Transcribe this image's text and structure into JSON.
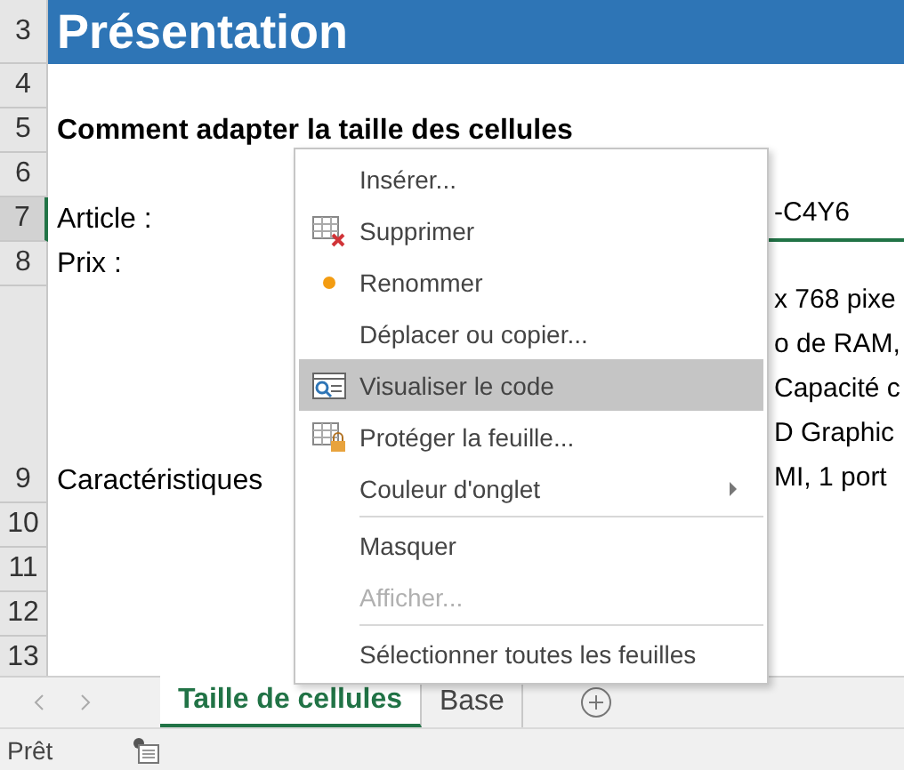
{
  "rows": [
    {
      "number": "3",
      "kind": "title",
      "selected": false,
      "label": "Présentation"
    },
    {
      "number": "4",
      "kind": "normal",
      "selected": false
    },
    {
      "number": "5",
      "kind": "heading",
      "selected": false,
      "label": "Comment adapter la taille des cellules"
    },
    {
      "number": "6",
      "kind": "normal",
      "selected": false
    },
    {
      "number": "7",
      "kind": "normal",
      "selected": true,
      "label": "Article :",
      "right_lines": [
        "-C4Y6"
      ]
    },
    {
      "number": "8",
      "kind": "normal",
      "selected": false,
      "label": "Prix :"
    },
    {
      "number": "9",
      "kind": "tall",
      "selected": false,
      "label": "Caractéristiques",
      "right_lines": [
        "x 768 pixe",
        "o de RAM,",
        "Capacité c",
        "D Graphic",
        "MI, 1 port"
      ]
    },
    {
      "number": "10",
      "kind": "normal",
      "selected": false
    },
    {
      "number": "11",
      "kind": "normal",
      "selected": false
    },
    {
      "number": "12",
      "kind": "normal",
      "selected": false
    },
    {
      "number": "13",
      "kind": "normal",
      "selected": false
    }
  ],
  "context_menu": [
    {
      "label": "Insérer...",
      "kind": "plain",
      "disabled": false,
      "selected": false,
      "submenu": false,
      "separator_before": false
    },
    {
      "label": "Supprimer",
      "kind": "delete",
      "disabled": false,
      "selected": false,
      "submenu": false,
      "separator_before": false
    },
    {
      "label": "Renommer",
      "kind": "dot",
      "disabled": false,
      "selected": false,
      "submenu": false,
      "separator_before": false
    },
    {
      "label": "Déplacer ou copier...",
      "kind": "plain",
      "disabled": false,
      "selected": false,
      "submenu": false,
      "separator_before": false
    },
    {
      "label": "Visualiser le code",
      "kind": "code",
      "disabled": false,
      "selected": true,
      "submenu": false,
      "separator_before": false
    },
    {
      "label": "Protéger la feuille...",
      "kind": "lock",
      "disabled": false,
      "selected": false,
      "submenu": false,
      "separator_before": false
    },
    {
      "label": "Couleur d'onglet",
      "kind": "plain",
      "disabled": false,
      "selected": false,
      "submenu": true,
      "separator_before": false
    },
    {
      "label": "Masquer",
      "kind": "plain",
      "disabled": false,
      "selected": false,
      "submenu": false,
      "separator_before": true
    },
    {
      "label": "Afficher...",
      "kind": "plain",
      "disabled": true,
      "selected": false,
      "submenu": false,
      "separator_before": false
    },
    {
      "label": "Sélectionner toutes les feuilles",
      "kind": "plain",
      "disabled": false,
      "selected": false,
      "submenu": false,
      "separator_before": true
    }
  ],
  "sheet_tabs": [
    {
      "label": "Taille de cellules",
      "selected": true
    },
    {
      "label": "Base",
      "selected": false
    }
  ],
  "status_bar": {
    "text": "Prêt"
  }
}
